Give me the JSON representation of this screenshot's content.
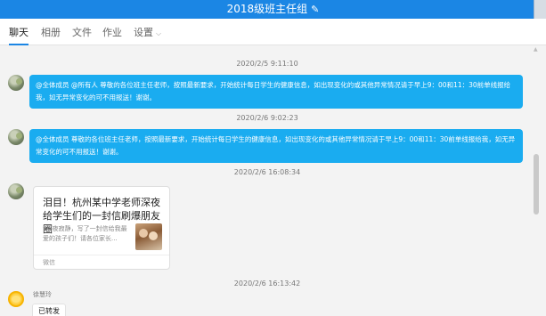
{
  "window": {
    "title": "2018级班主任组"
  },
  "tabs": [
    {
      "label": "聊天",
      "active": true
    },
    {
      "label": "相册",
      "active": false
    },
    {
      "label": "文件",
      "active": false
    },
    {
      "label": "作业",
      "active": false
    },
    {
      "label": "设置",
      "active": false
    }
  ],
  "messages": [
    {
      "timestamp": "2020/2/5 9:11:10",
      "text": "@全体成员 @所有人 尊敬的各位班主任老师，按照最新要求，开始统计每日学生的健康信息，如出现变化的或其他异常情况请于早上9：00和11：30前单线报给我，如无异常变化的可不用报送！谢谢。"
    },
    {
      "timestamp": "2020/2/6 9:02:23",
      "text": "@全体成员 尊敬的各位班主任老师，按照最新要求，开始统计每日学生的健康信息，如出现变化的或其他异常情况请于早上9：00和11：30前单线报给我，如无异常变化的可不用报送！谢谢。"
    },
    {
      "timestamp": "2020/2/6 16:08:34",
      "card": {
        "title": "泪目！杭州某中学老师深夜给学生们的一封信刷爆朋友圈",
        "desc": "“深夜寂静，写了一封信给我最爱的孩子们！请各位家长...",
        "source": "微信"
      }
    },
    {
      "timestamp": "2020/2/6 16:13:42",
      "sender": "徐慧玲",
      "text": "已转发"
    }
  ],
  "colors": {
    "titlebar": "#1b86e4",
    "bubble": "#1aacf0"
  }
}
